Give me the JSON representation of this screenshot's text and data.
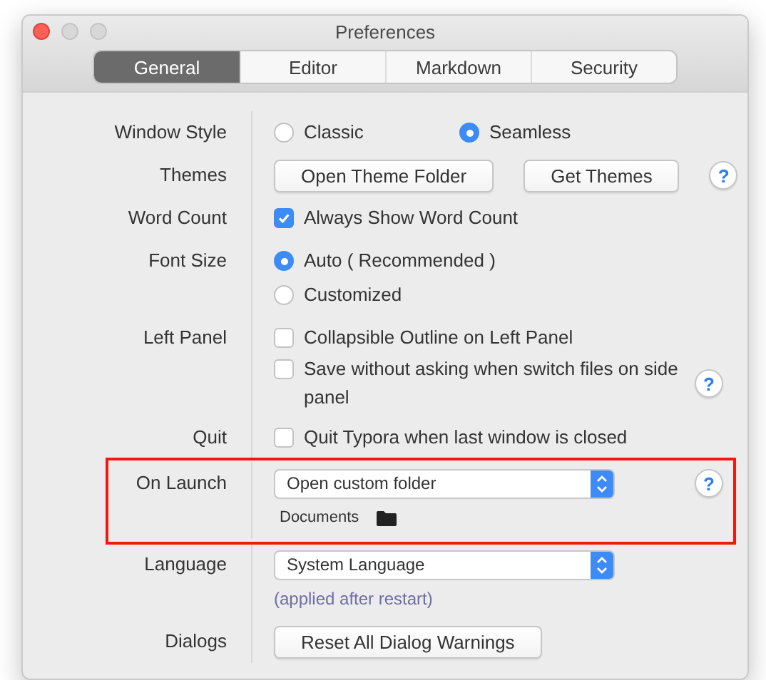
{
  "window": {
    "title": "Preferences"
  },
  "tabs": [
    {
      "label": "General",
      "selected": true
    },
    {
      "label": "Editor",
      "selected": false
    },
    {
      "label": "Markdown",
      "selected": false
    },
    {
      "label": "Security",
      "selected": false
    }
  ],
  "rows": [
    {
      "label": "Window Style",
      "highlighted": false,
      "lines": [
        [
          {
            "kind": "radio",
            "label": "Classic",
            "selected": false
          },
          {
            "kind": "radio",
            "label": "Seamless",
            "selected": true
          }
        ]
      ]
    },
    {
      "label": "Themes",
      "highlighted": false,
      "lines": [
        [
          {
            "kind": "button",
            "label": "Open Theme Folder"
          },
          {
            "kind": "button",
            "label": "Get Themes"
          },
          {
            "kind": "help",
            "label": "?"
          }
        ]
      ]
    },
    {
      "label": "Word Count",
      "highlighted": false,
      "lines": [
        [
          {
            "kind": "checkbox",
            "label": "Always Show Word Count",
            "checked": true
          }
        ]
      ]
    },
    {
      "label": "Font Size",
      "highlighted": false,
      "lines": [
        [
          {
            "kind": "radio",
            "label": "Auto ( Recommended )",
            "selected": true
          }
        ],
        [
          {
            "kind": "radio",
            "label": "Customized",
            "selected": false
          }
        ]
      ]
    },
    {
      "label": "Left Panel",
      "highlighted": false,
      "lines": [
        [
          {
            "kind": "checkbox",
            "label": "Collapsible Outline on Left Panel",
            "checked": false
          }
        ],
        [
          {
            "kind": "checkbox",
            "label": "Save without asking when switch files on side panel",
            "checked": false
          },
          {
            "kind": "help",
            "label": "?"
          }
        ]
      ]
    },
    {
      "label": "Quit",
      "highlighted": false,
      "lines": [
        [
          {
            "kind": "checkbox",
            "label": "Quit Typora when last window is closed",
            "checked": false
          }
        ]
      ]
    },
    {
      "label": "On Launch",
      "highlighted": true,
      "lines": [
        [
          {
            "kind": "select",
            "label": "Open custom folder"
          },
          {
            "kind": "help",
            "label": "?"
          }
        ],
        [
          {
            "kind": "path",
            "label": "Documents"
          }
        ]
      ]
    },
    {
      "label": "Language",
      "highlighted": false,
      "lines": [
        [
          {
            "kind": "select",
            "label": "System Language"
          }
        ],
        [
          {
            "kind": "hint",
            "label": "(applied after restart)"
          }
        ]
      ]
    },
    {
      "label": "Dialogs",
      "highlighted": false,
      "lines": [
        [
          {
            "kind": "button",
            "label": "Reset All Dialog Warnings"
          }
        ]
      ]
    }
  ]
}
